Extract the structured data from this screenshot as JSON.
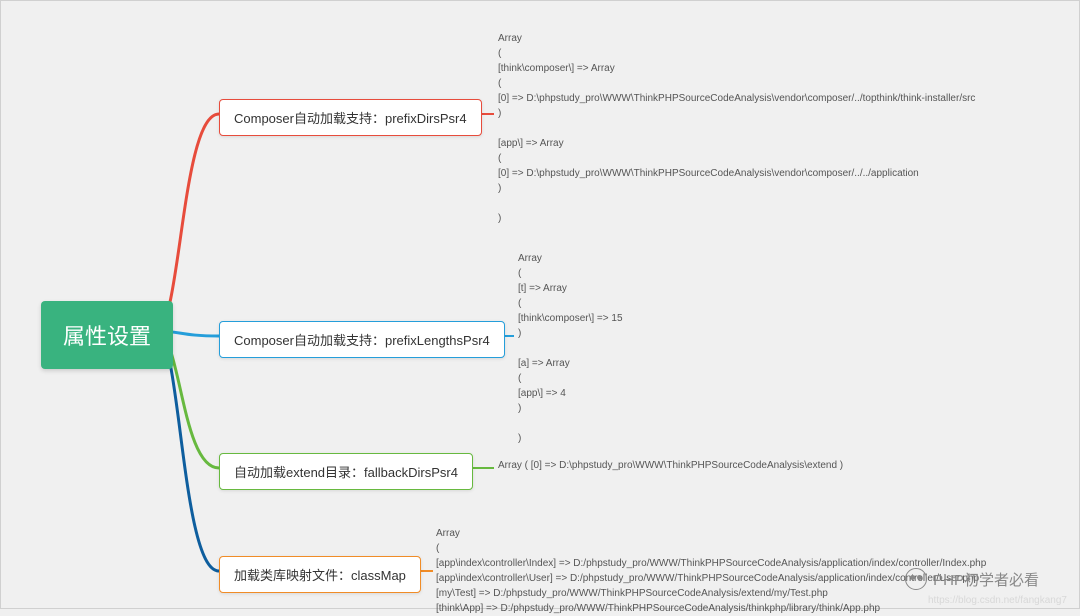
{
  "root": {
    "label": "属性设置"
  },
  "children": [
    {
      "label": "Composer自动加载支持：prefixDirsPsr4",
      "color": "#e74c3c",
      "text": "Array\n(\n[think\\composer\\] => Array\n(\n[0] => D:\\phpstudy_pro\\WWW\\ThinkPHPSourceCodeAnalysis\\vendor\\composer/../topthink/think-installer/src\n)\n\n[app\\] => Array\n(\n[0] => D:\\phpstudy_pro\\WWW\\ThinkPHPSourceCodeAnalysis\\vendor\\composer/../../application\n)\n\n)"
    },
    {
      "label": "Composer自动加载支持：prefixLengthsPsr4",
      "color": "#259eda",
      "text": "Array\n(\n[t] => Array\n(\n[think\\composer\\] => 15\n)\n\n[a] => Array\n(\n[app\\] => 4\n)\n\n)"
    },
    {
      "label": "自动加载extend目录：fallbackDirsPsr4",
      "color": "#67b93f",
      "text": "Array ( [0] => D:\\phpstudy_pro\\WWW\\ThinkPHPSourceCodeAnalysis\\extend )"
    },
    {
      "label": "加载类库映射文件：classMap",
      "color": "#f08c27",
      "text": "Array\n(\n[app\\index\\controller\\Index] => D:/phpstudy_pro/WWW/ThinkPHPSourceCodeAnalysis/application/index/controller/Index.php\n[app\\index\\controller\\User] => D:/phpstudy_pro/WWW/ThinkPHPSourceCodeAnalysis/application/index/controller/User.php\n[my\\Test] => D:/phpstudy_pro/WWW/ThinkPHPSourceCodeAnalysis/extend/my/Test.php\n[think\\App] => D:/phpstudy_pro/WWW/ThinkPHPSourceCodeAnalysis/thinkphp/library/think/App.php"
    }
  ],
  "watermark": "PHP初学者必看",
  "footer_url": "https://blog.csdn.net/fangkang7"
}
